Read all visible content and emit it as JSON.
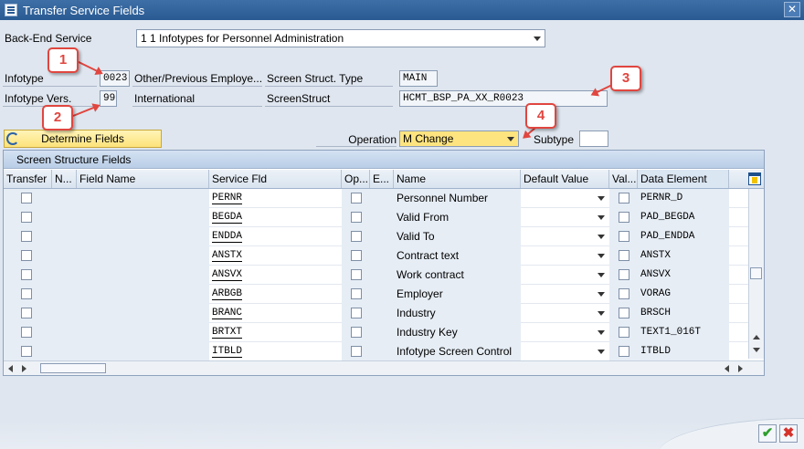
{
  "window": {
    "title": "Transfer Service Fields",
    "close_glyph": "✕"
  },
  "header": {
    "backend_service_label": "Back-End Service",
    "backend_service_value": "1 1 Infotypes for Personnel Administration",
    "infotype_label": "Infotype",
    "infotype_value": "0023",
    "infotype_desc": "Other/Previous Employe...",
    "infotype_vers_label": "Infotype Vers.",
    "infotype_vers_value": "99",
    "infotype_vers_desc": "International",
    "screen_struct_type_label": "Screen Struct. Type",
    "screen_struct_type_value": "MAIN",
    "screen_struct_label": "ScreenStruct",
    "screen_struct_value": "HCMT_BSP_PA_XX_R0023"
  },
  "toolbar": {
    "determine_fields_label": "Determine Fields",
    "operation_label": "Operation",
    "operation_value": "M Change",
    "subtype_label": "Subtype",
    "subtype_value": ""
  },
  "grid": {
    "title": "Screen Structure Fields",
    "columns": [
      "Transfer",
      "N...",
      "Field Name",
      "Service Fld",
      "Op...",
      "E...",
      "Name",
      "Default Value",
      "Val...",
      "Data Element"
    ],
    "rows": [
      {
        "service_fld": "PERNR",
        "name": "Personnel Number",
        "data_element": "PERNR_D"
      },
      {
        "service_fld": "BEGDA",
        "name": "Valid From",
        "data_element": "PAD_BEGDA"
      },
      {
        "service_fld": "ENDDA",
        "name": "Valid To",
        "data_element": "PAD_ENDDA"
      },
      {
        "service_fld": "ANSTX",
        "name": "Contract text",
        "data_element": "ANSTX"
      },
      {
        "service_fld": "ANSVX",
        "name": "Work contract",
        "data_element": "ANSVX"
      },
      {
        "service_fld": "ARBGB",
        "name": "Employer",
        "data_element": "VORAG"
      },
      {
        "service_fld": "BRANC",
        "name": "Industry",
        "data_element": "BRSCH"
      },
      {
        "service_fld": "BRTXT",
        "name": "Industry Key",
        "data_element": "TEXT1_016T"
      },
      {
        "service_fld": "ITBLD",
        "name": "Infotype Screen Control",
        "data_element": "ITBLD"
      }
    ]
  },
  "callouts": [
    "1",
    "2",
    "3",
    "4"
  ],
  "footer": {
    "ok_glyph": "✔",
    "cancel_glyph": "✖"
  },
  "colors": {
    "accent": "#e0463f",
    "titlebar": "#2a5a92",
    "highlight": "#fde47f"
  }
}
